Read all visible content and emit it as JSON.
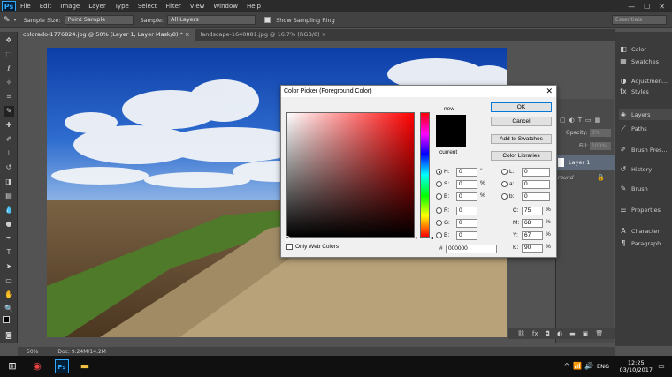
{
  "app": {
    "logo": "Ps"
  },
  "menubar": {
    "items": [
      "File",
      "Edit",
      "Image",
      "Layer",
      "Type",
      "Select",
      "Filter",
      "View",
      "Window",
      "Help"
    ],
    "window_controls": [
      "—",
      "☐",
      "✕"
    ]
  },
  "options_bar": {
    "sample_size_label": "Sample Size:",
    "sample_size_value": "Point Sample",
    "sample_label": "Sample:",
    "sample_value": "All Layers",
    "show_ring_label": "Show Sampling Ring",
    "workspace_value": "Essentials"
  },
  "tabs": [
    {
      "label": "colorado-1776824.jpg @ 50% (Layer 1, Layer Mask/8) *",
      "close": "×"
    },
    {
      "label": "landscape-1640881.jpg @ 16.7% (RGB/8)",
      "close": "×"
    }
  ],
  "status": {
    "zoom": "50%",
    "doc": "Doc: 9.24M/14.2M"
  },
  "right_panels": [
    {
      "label": "Color",
      "icon": "color-icon"
    },
    {
      "label": "Swatches",
      "icon": "swatches-icon"
    },
    {
      "label": "Adjustmen...",
      "icon": "adjustments-icon"
    },
    {
      "label": "Styles",
      "icon": "styles-icon"
    },
    {
      "label": "Layers",
      "icon": "layers-icon"
    },
    {
      "label": "Paths",
      "icon": "paths-icon"
    },
    {
      "label": "Brush Pres...",
      "icon": "brush-presets-icon"
    },
    {
      "label": "History",
      "icon": "history-icon"
    },
    {
      "label": "Brush",
      "icon": "brush-icon"
    },
    {
      "label": "Properties",
      "icon": "properties-icon"
    },
    {
      "label": "Character",
      "icon": "character-icon"
    },
    {
      "label": "Paragraph",
      "icon": "paragraph-icon"
    }
  ],
  "layers_panel": {
    "opacity_label": "Opacity:",
    "opacity_value": "0%",
    "fill_label": "Fill:",
    "fill_value": "100%",
    "layer_name": "Layer 1",
    "background_label": "round"
  },
  "dialog": {
    "title": "Color Picker (Foreground Color)",
    "close": "✕",
    "new_label": "new",
    "current_label": "current",
    "ok": "OK",
    "cancel": "Cancel",
    "add_swatches": "Add to Swatches",
    "color_libraries": "Color Libraries",
    "only_web_colors": "Only Web Colors",
    "hex_prefix": "#",
    "hex_value": "000000",
    "hsb": [
      {
        "label": "H:",
        "value": "0",
        "unit": "°",
        "selected": true
      },
      {
        "label": "S:",
        "value": "0",
        "unit": "%"
      },
      {
        "label": "B:",
        "value": "0",
        "unit": "%"
      }
    ],
    "rgb": [
      {
        "label": "R:",
        "value": "0"
      },
      {
        "label": "G:",
        "value": "0"
      },
      {
        "label": "B:",
        "value": "0"
      }
    ],
    "lab": [
      {
        "label": "L:",
        "value": "0"
      },
      {
        "label": "a:",
        "value": "0"
      },
      {
        "label": "b:",
        "value": "0"
      }
    ],
    "cmyk": [
      {
        "label": "C:",
        "value": "75",
        "unit": "%"
      },
      {
        "label": "M:",
        "value": "68",
        "unit": "%"
      },
      {
        "label": "Y:",
        "value": "67",
        "unit": "%"
      },
      {
        "label": "K:",
        "value": "90",
        "unit": "%"
      }
    ]
  },
  "taskbar": {
    "lang": "ENG",
    "time": "12:25",
    "date": "03/10/2017"
  },
  "colors": {
    "accent": "#0078d7",
    "ps_blue": "#31a8ff"
  }
}
